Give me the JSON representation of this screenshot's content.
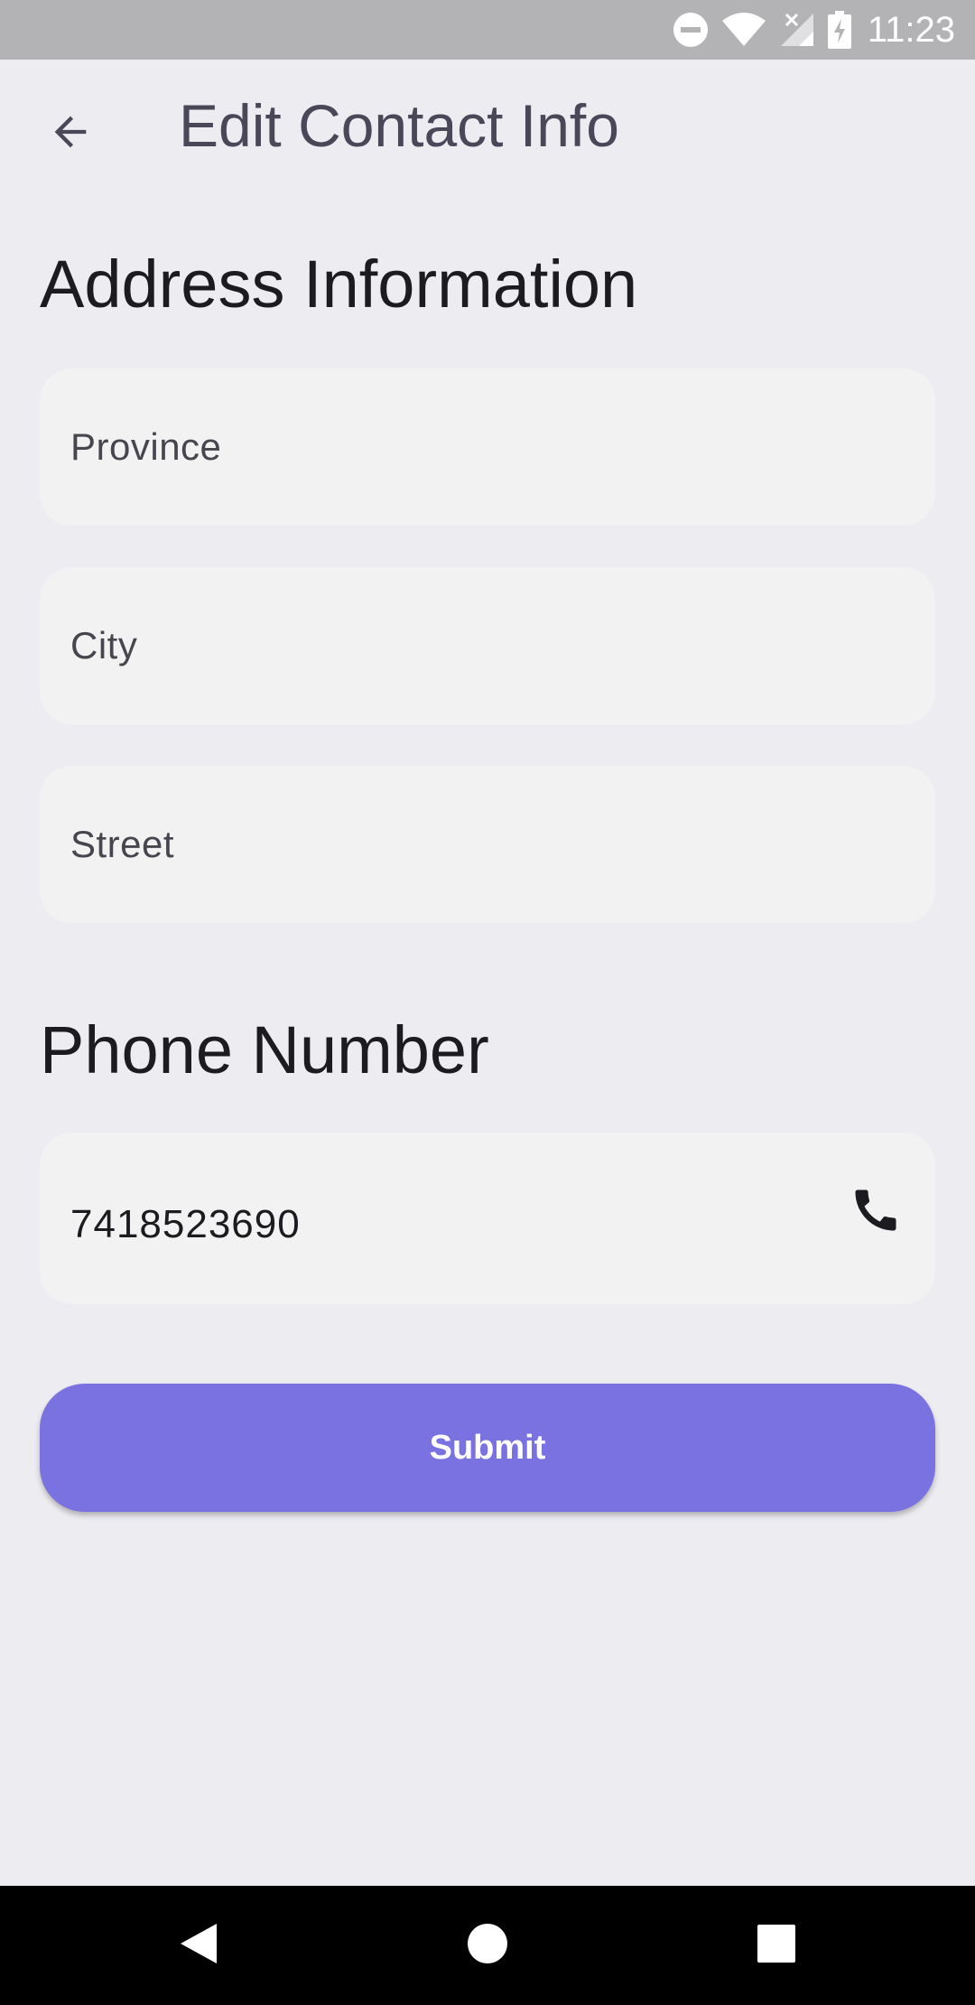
{
  "status_bar": {
    "time": "11:23",
    "icons": [
      "do-not-disturb-icon",
      "wifi-icon",
      "no-signal-icon",
      "battery-charging-icon"
    ]
  },
  "app_bar": {
    "title": "Edit Contact Info",
    "back_icon": "arrow-back-icon"
  },
  "address_section": {
    "title": "Address Information",
    "fields": [
      {
        "label": "Province",
        "value": ""
      },
      {
        "label": "City",
        "value": ""
      },
      {
        "label": "Street",
        "value": ""
      }
    ]
  },
  "phone_section": {
    "title": "Phone Number",
    "value": "7418523690",
    "icon": "phone-icon"
  },
  "submit": {
    "label": "Submit"
  },
  "nav_bar": {
    "icons": [
      "back-triangle-icon",
      "home-circle-icon",
      "recents-square-icon"
    ]
  },
  "colors": {
    "background": "#EDECF1",
    "field_background": "#F2F2F3",
    "accent": "#7B72E1",
    "status_bar": "#B3B3B5"
  }
}
